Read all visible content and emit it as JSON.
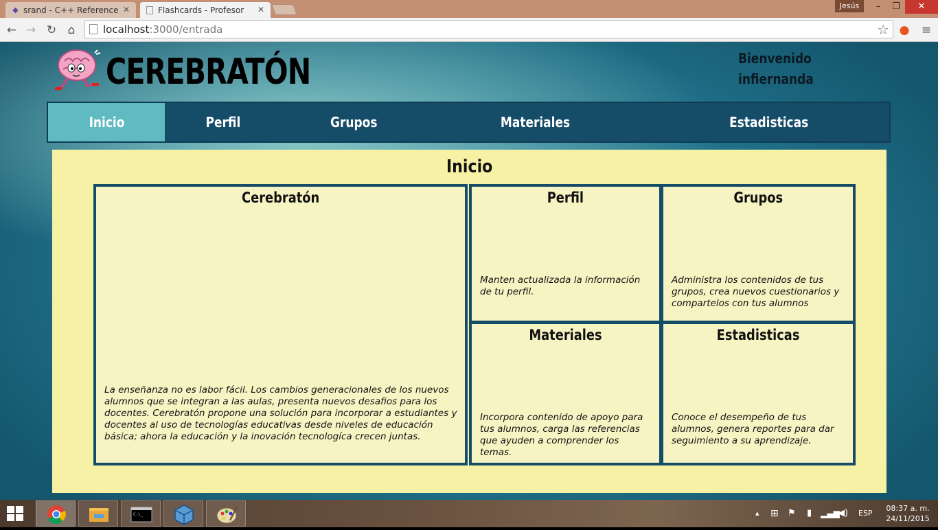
{
  "browser": {
    "tabs": [
      {
        "title": "srand - C++ Reference",
        "active": false
      },
      {
        "title": "Flashcards - Profesor",
        "active": true
      }
    ],
    "user_badge": "Jesús",
    "url_host": "localhost",
    "url_path": ":3000/entrada",
    "window_controls": {
      "minimize": "–",
      "maximize": "❐",
      "close": "✕"
    }
  },
  "header": {
    "brand": "CEREBRATÓN",
    "welcome_line1": "Bienvenido",
    "welcome_line2": "infiernanda"
  },
  "nav": {
    "items": [
      {
        "label": "Inicio",
        "active": true
      },
      {
        "label": "Perfil"
      },
      {
        "label": "Grupos"
      },
      {
        "label": "Materiales"
      },
      {
        "label": "Estadisticas"
      }
    ]
  },
  "content": {
    "title": "Inicio",
    "cards": {
      "cerebraton": {
        "title": "Cerebratón",
        "description": "La enseñanza no es labor fácil. Los cambios generacionales de los nuevos alumnos que se integran a las aulas, presenta nuevos desafios para los docentes. Cerebratón propone una solución para incorporar a estudiantes y docentes al uso de tecnologías educativas desde niveles de educación básica; ahora la educación y la inovación tecnologíca crecen juntas."
      },
      "perfil": {
        "title": "Perfil",
        "description": "Manten actualizada la información de tu perfil."
      },
      "grupos": {
        "title": "Grupos",
        "description": "Administra los contenidos de tus grupos, crea nuevos cuestionarios y compartelos con tus alumnos"
      },
      "materiales": {
        "title": "Materiales",
        "description": "Incorpora contenido de apoyo para tus alumnos, carga las referencias que ayuden a comprender los temas."
      },
      "estadisticas": {
        "title": "Estadisticas",
        "description": "Conoce el desempeño de tus alumnos, genera reportes para dar seguimiento a su aprendizaje."
      }
    }
  },
  "taskbar": {
    "language": "ESP",
    "time": "08:37 a. m.",
    "date": "24/11/2015"
  },
  "colors": {
    "nav_background": "#154c68",
    "nav_active": "#5fbac2",
    "content_background": "#f6f1a4",
    "card_border": "#154c68"
  }
}
